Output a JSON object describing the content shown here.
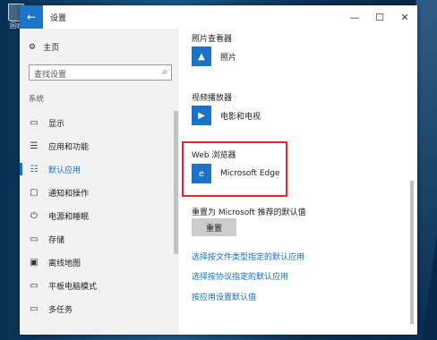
{
  "desktop": {
    "recycle_label": "回收"
  },
  "window": {
    "title": "设置",
    "back_icon": "←",
    "minimize": "—",
    "maximize": "☐",
    "close": "✕"
  },
  "sidebar": {
    "home": {
      "icon": "⚙",
      "label": "主页"
    },
    "search": {
      "placeholder": "查找设置",
      "icon": "⌕"
    },
    "section": "系统",
    "items": [
      {
        "icon": "▭",
        "label": "显示"
      },
      {
        "icon": "☰",
        "label": "应用和功能"
      },
      {
        "icon": "☷",
        "label": "默认应用",
        "active": true
      },
      {
        "icon": "▢",
        "label": "通知和操作"
      },
      {
        "icon": "⏻",
        "label": "电源和睡眠"
      },
      {
        "icon": "▭",
        "label": "存储"
      },
      {
        "icon": "▣",
        "label": "离线地图"
      },
      {
        "icon": "▭",
        "label": "平板电脑模式"
      },
      {
        "icon": "▭",
        "label": "多任务"
      }
    ]
  },
  "main": {
    "photo": {
      "heading": "照片查看器",
      "app": "照片",
      "tile_color": "#1a73c7"
    },
    "video": {
      "heading": "视频播放器",
      "app": "电影和电视",
      "tile_color": "#1a73c7"
    },
    "web": {
      "heading": "Web 浏览器",
      "app": "Microsoft Edge",
      "tile_color": "#1a73c7",
      "tile_icon": "e"
    },
    "reset": {
      "heading": "重置为 Microsoft 推荐的默认值",
      "button": "重置"
    },
    "links": [
      "选择按文件类型指定的默认应用",
      "选择按协议指定的默认应用",
      "按应用设置默认值"
    ]
  },
  "colors": {
    "accent": "#1a73c7",
    "highlight_border": "#e0282e"
  }
}
